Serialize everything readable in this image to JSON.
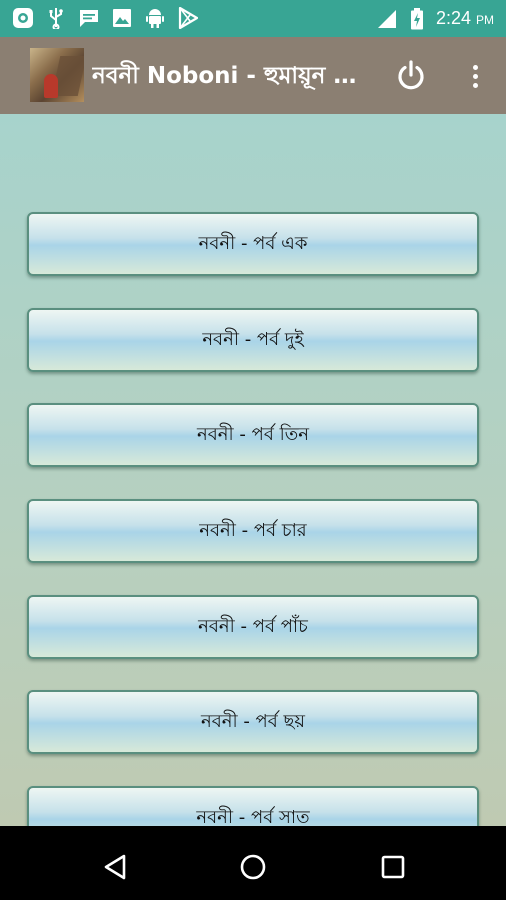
{
  "status_bar": {
    "time": "2:24",
    "ampm": "PM",
    "icons": [
      "camera-notification-icon",
      "usb-icon",
      "message-icon",
      "image-icon",
      "android-icon",
      "play-store-icon",
      "signal-icon",
      "battery-icon"
    ]
  },
  "app_bar": {
    "title": "নবনী Noboni - হুমায়ূন আহমেদ",
    "icons": [
      "app-logo",
      "power-icon",
      "more-vert-icon"
    ]
  },
  "chapters": [
    {
      "label": "নবনী - পর্ব এক"
    },
    {
      "label": "নবনী - পর্ব দুই"
    },
    {
      "label": "নবনী - পর্ব তিন"
    },
    {
      "label": "নবনী - পর্ব চার"
    },
    {
      "label": "নবনী - পর্ব পাঁচ"
    },
    {
      "label": "নবনী - পর্ব ছয়"
    },
    {
      "label": "নবনী - পর্ব সাত"
    }
  ],
  "nav_bar": {
    "icons": [
      "back-icon",
      "home-icon",
      "recents-icon"
    ]
  },
  "colors": {
    "status_bar": "#38a594",
    "app_bar": "#8b7f72",
    "content_top": "#a7d3cc",
    "content_bottom": "#bfcab2",
    "button_border": "#5a8f7f"
  }
}
